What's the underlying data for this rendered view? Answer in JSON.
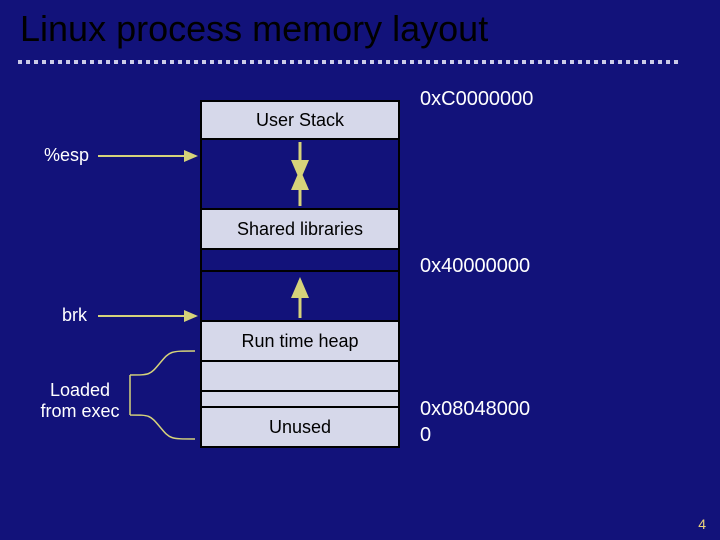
{
  "title": "Linux process memory layout",
  "page_number": "4",
  "column": {
    "user_stack": "User Stack",
    "shared_libs": "Shared libraries",
    "runtime_heap": "Run time heap",
    "unused": "Unused"
  },
  "left_labels": {
    "esp": "%esp",
    "brk": "brk",
    "loaded": "Loaded\nfrom exec"
  },
  "right_labels": {
    "addr_c": "0xC0000000",
    "addr_4": "0x40000000",
    "addr_08": "0x08048000",
    "addr_0": "0"
  }
}
